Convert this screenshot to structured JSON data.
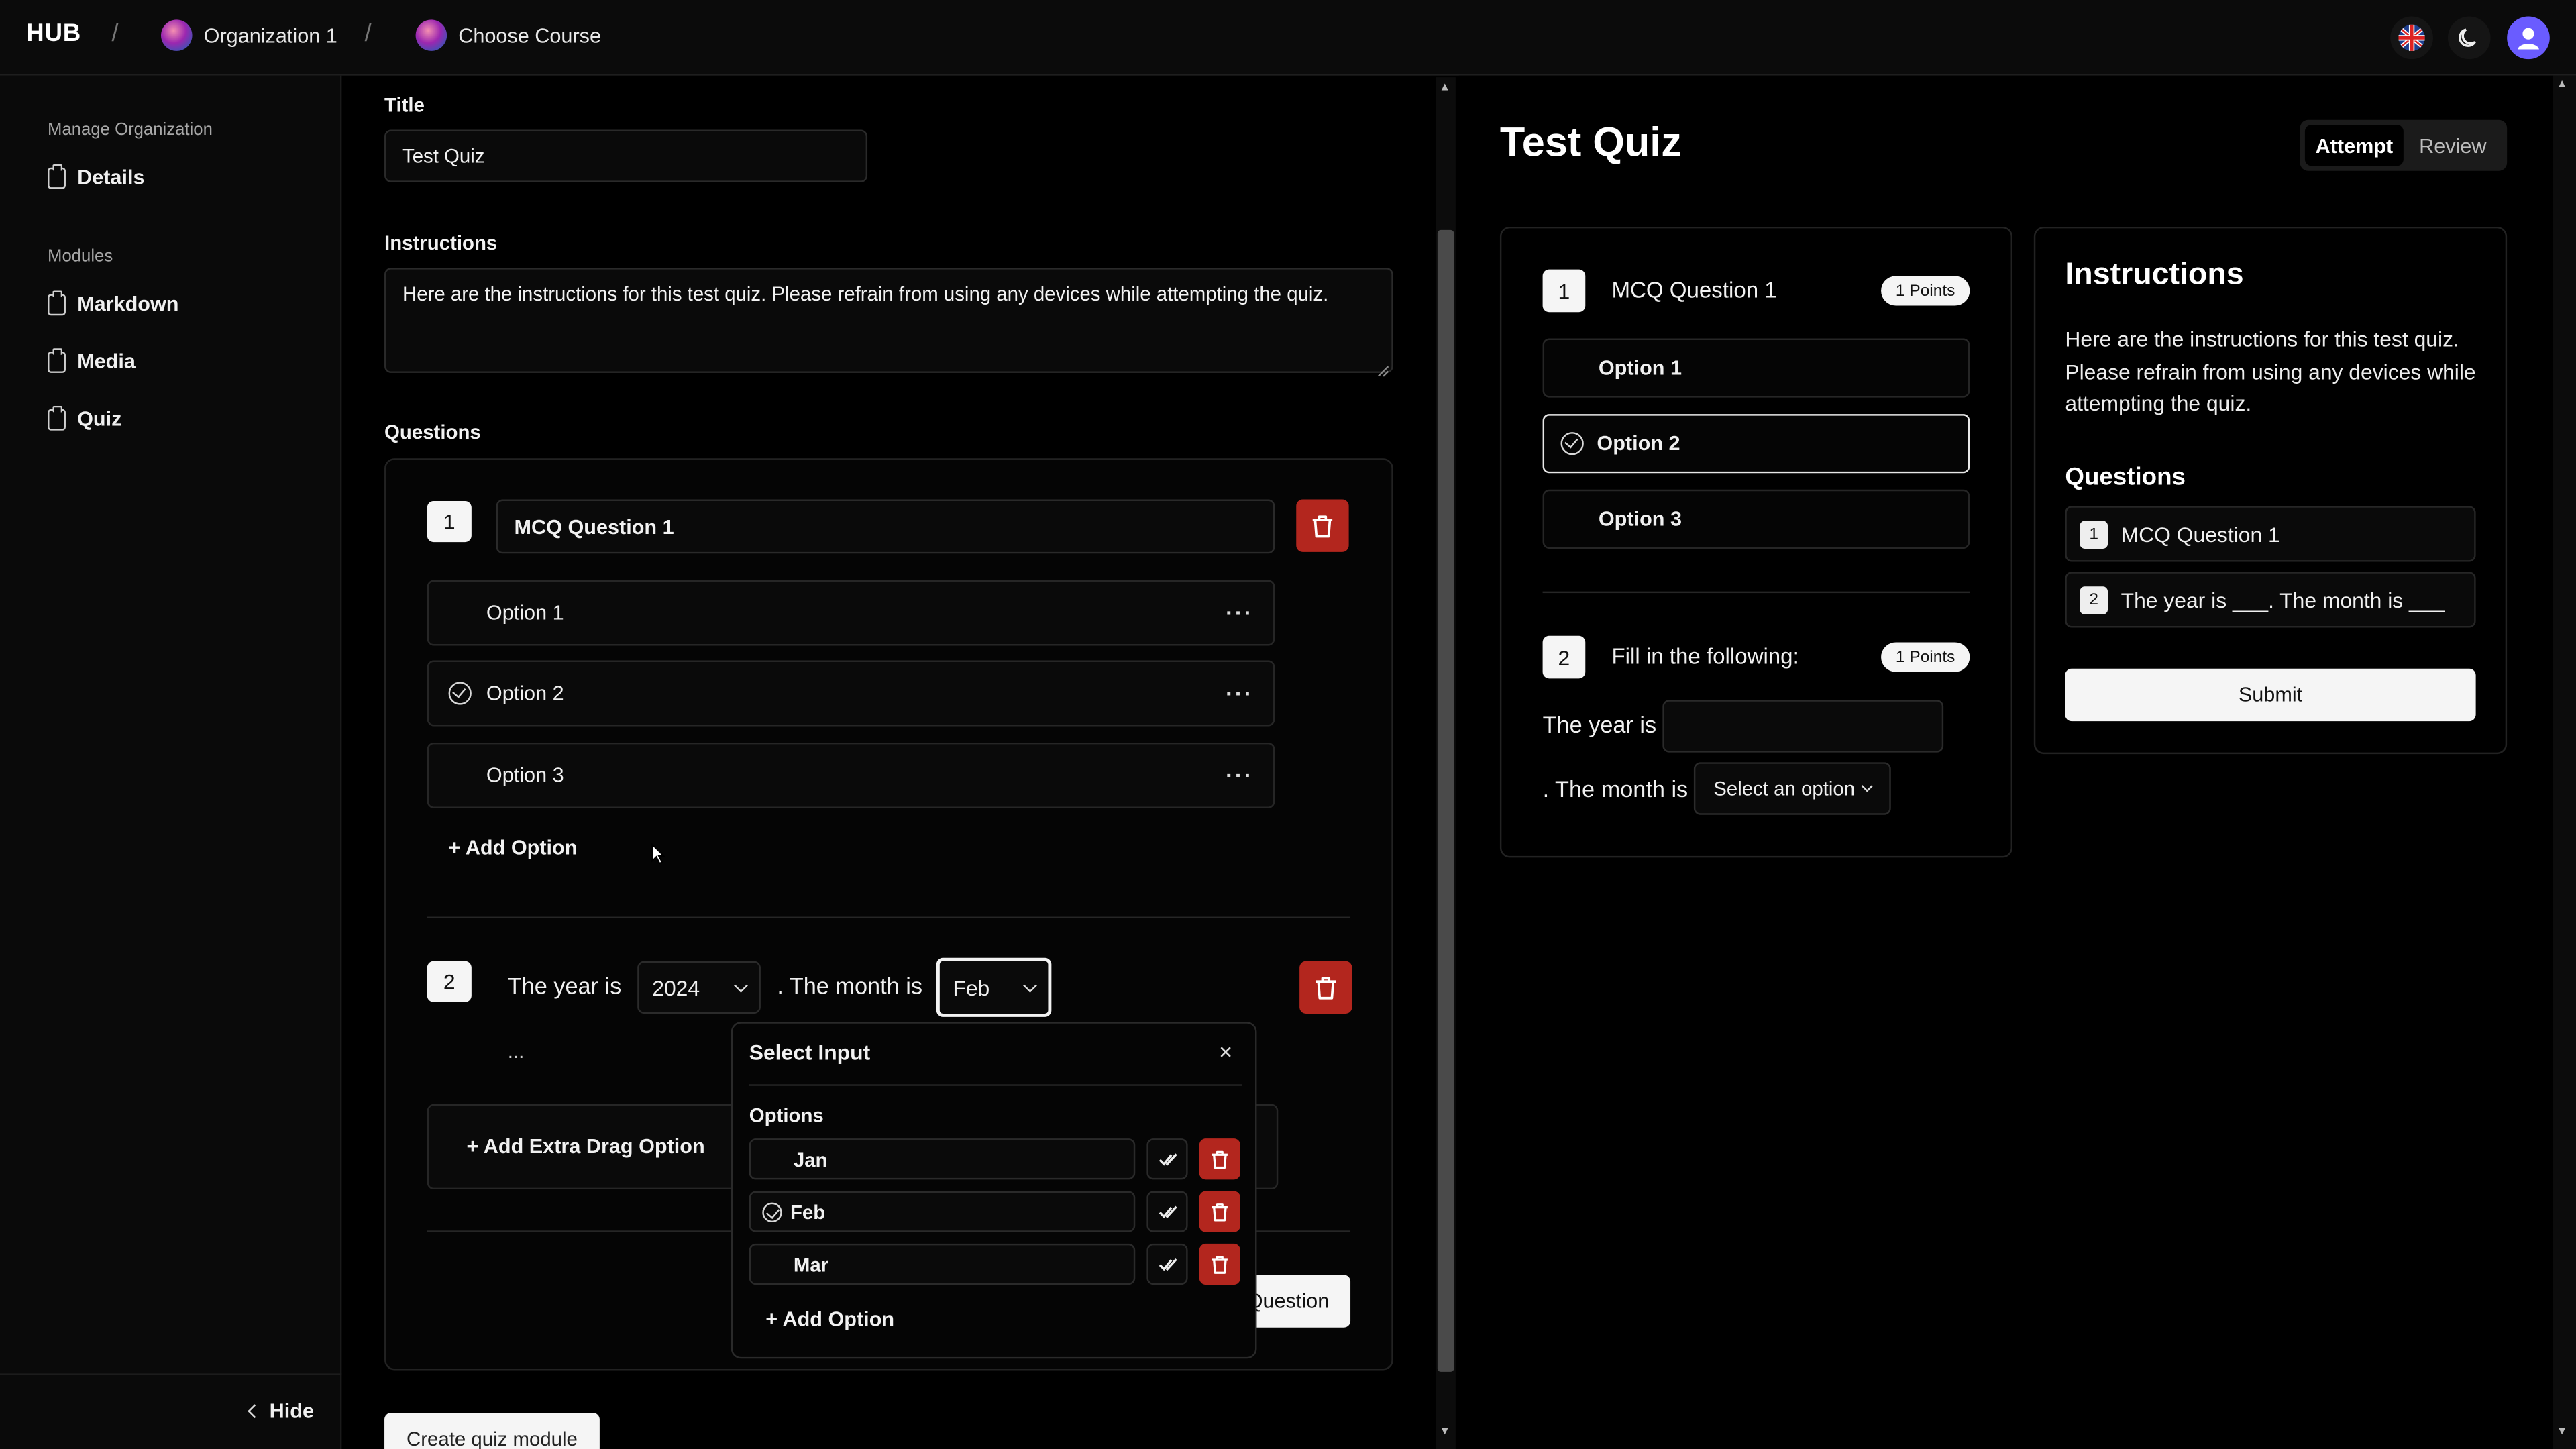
{
  "header": {
    "brand": "HUB",
    "breadcrumbs": [
      {
        "label": "Organization 1"
      },
      {
        "label": "Choose Course"
      }
    ],
    "icons": [
      "language-flag-icon",
      "theme-moon-icon",
      "user-avatar-icon"
    ]
  },
  "sidebar": {
    "section_manage": "Manage Organization",
    "item_details": "Details",
    "section_modules": "Modules",
    "item_markdown": "Markdown",
    "item_media": "Media",
    "item_quiz": "Quiz",
    "hide": "Hide"
  },
  "editor": {
    "title_label": "Title",
    "title_value": "Test Quiz",
    "instructions_label": "Instructions",
    "instructions_value": "Here are the instructions for this test quiz. Please refrain from using any devices while attempting the quiz.",
    "questions_label": "Questions",
    "q1": {
      "number": "1",
      "text": "MCQ Question 1",
      "options": [
        "Option 1",
        "Option 2",
        "Option 3"
      ],
      "correct_option": "Option 2",
      "add_option": "+ Add Option"
    },
    "q2": {
      "number": "2",
      "prefix": "The year is",
      "year_value": "2024",
      "middle": ". The month is",
      "month_value": "Feb",
      "ellipsis": "...",
      "add_drag": "+ Add Extra Drag Option",
      "add_question_partial": "Question"
    },
    "create_button": "Create quiz module"
  },
  "popover": {
    "title": "Select Input",
    "close": "×",
    "options_label": "Options",
    "options": [
      "Jan",
      "Feb",
      "Mar"
    ],
    "selected": "Feb",
    "add_option": "+ Add Option"
  },
  "preview": {
    "title": "Test Quiz",
    "tab_attempt": "Attempt",
    "tab_review": "Review",
    "q1": {
      "number": "1",
      "text": "MCQ Question 1",
      "points": "1 Points",
      "options": [
        "Option 1",
        "Option 2",
        "Option 3"
      ]
    },
    "q2": {
      "number": "2",
      "text": "Fill in the following:",
      "points": "1 Points",
      "year_prefix": "The year is",
      "month_prefix": ". The month is",
      "select_placeholder": "Select an option"
    },
    "instructions_title": "Instructions",
    "instructions_text": "Here are the instructions for this test quiz. Please refrain from using any devices while attempting the quiz.",
    "questions_title": "Questions",
    "question_list": [
      {
        "number": "1",
        "text": "MCQ Question 1"
      },
      {
        "number": "2",
        "text": "The year is ___. The month is ___"
      }
    ],
    "submit": "Submit"
  },
  "colors": {
    "danger": "#b3261e",
    "background": "#000000",
    "surface": "#0a0a0a",
    "text": "#f2f2f2"
  }
}
